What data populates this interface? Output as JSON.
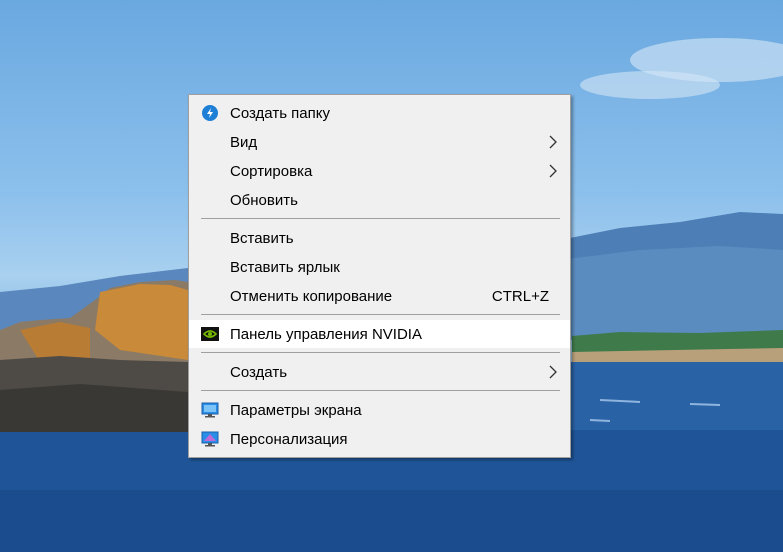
{
  "context_menu": {
    "items": [
      {
        "label": "Создать папку",
        "icon": "new-folder-icon"
      },
      {
        "label": "Вид",
        "submenu": true
      },
      {
        "label": "Сортировка",
        "submenu": true
      },
      {
        "label": "Обновить"
      },
      {
        "label": "Вставить"
      },
      {
        "label": "Вставить ярлык"
      },
      {
        "label": "Отменить копирование",
        "shortcut": "CTRL+Z"
      },
      {
        "label": "Панель управления NVIDIA",
        "icon": "nvidia-icon",
        "highlighted": true
      },
      {
        "label": "Создать",
        "submenu": true
      },
      {
        "label": "Параметры экрана",
        "icon": "display-settings-icon"
      },
      {
        "label": "Персонализация",
        "icon": "personalization-icon"
      }
    ]
  },
  "colors": {
    "menu_background": "#f0f0f0",
    "highlight": "#ffffff",
    "nvidia_green": "#76b900",
    "folder_blue": "#1e7fd6"
  }
}
